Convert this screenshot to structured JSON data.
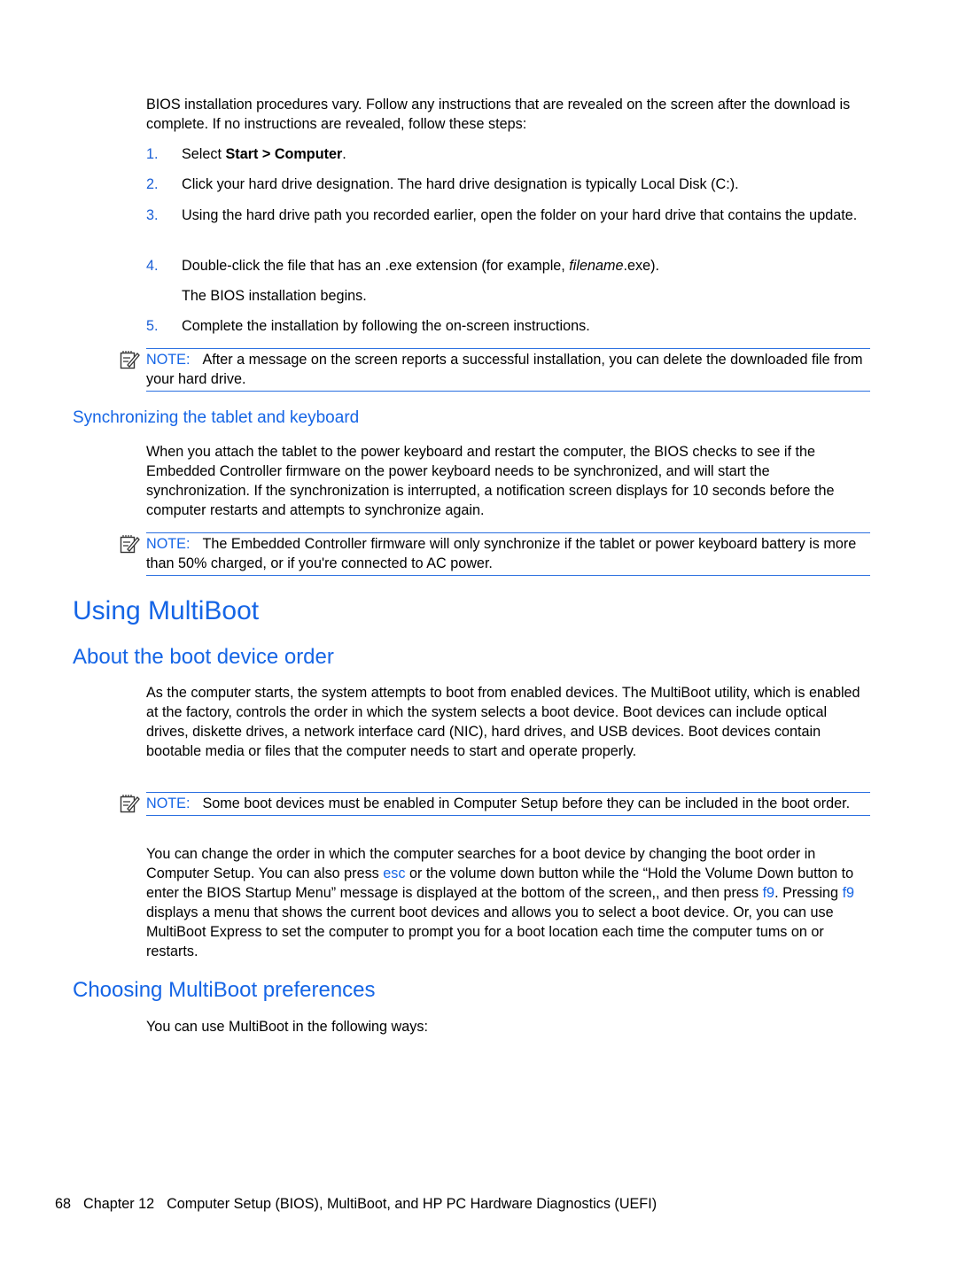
{
  "intro": {
    "text": "BIOS installation procedures vary. Follow any instructions that are revealed on the screen after the download is complete. If no instructions are revealed, follow these steps:"
  },
  "steps": [
    {
      "num": "1.",
      "pre": "Select ",
      "bold": "Start > Computer",
      "post": "."
    },
    {
      "num": "2.",
      "text": "Click your hard drive designation. The hard drive designation is typically Local Disk (C:)."
    },
    {
      "num": "3.",
      "text": "Using the hard drive path you recorded earlier, open the folder on your hard drive that contains the update."
    },
    {
      "num": "4.",
      "pre": "Double-click the file that has an .exe extension (for example, ",
      "italic": "filename",
      "post": ".exe).",
      "sub": "The BIOS installation begins."
    },
    {
      "num": "5.",
      "text": "Complete the installation by following the on-screen instructions."
    }
  ],
  "note_label": "NOTE:",
  "notes": [
    {
      "text": "After a message on the screen reports a successful installation, you can delete the downloaded file from your hard drive."
    },
    {
      "text": "The Embedded Controller firmware will only synchronize if the tablet or power keyboard battery is more than 50% charged, or if you're connected to AC power."
    },
    {
      "text": "Some boot devices must be enabled in Computer Setup before they can be included in the boot order."
    }
  ],
  "sections": {
    "sync": {
      "heading": "Synchronizing the tablet and keyboard",
      "body": "When you attach the tablet to the power keyboard and restart the computer, the BIOS checks to see if the Embedded Controller firmware on the power keyboard needs to be synchronized, and will start the synchronization. If the synchronization is interrupted, a notification screen displays for 10 seconds before the computer restarts and attempts to synchronize again."
    },
    "multiboot": {
      "heading": "Using MultiBoot"
    },
    "boot_order": {
      "heading": "About the boot device order",
      "body": "As the computer starts, the system attempts to boot from enabled devices. The MultiBoot utility, which is enabled at the factory, controls the order in which the system selects a boot device. Boot devices can include optical drives, diskette drives, a network interface card (NIC), hard drives, and USB devices. Boot devices contain bootable media or files that the computer needs to start and operate properly.",
      "body2": {
        "p1": "You can change the order in which the computer searches for a boot device by changing the boot order in Computer Setup. You can also press ",
        "key1": "esc",
        "p2": " or the volume down button while the “Hold the Volume Down button to enter the BIOS Startup Menu” message is displayed at the bottom of the screen,, and then press ",
        "key2": "f9",
        "p3": ". Pressing ",
        "key3": "f9",
        "p4": " displays a menu that shows the current boot devices and allows you to select a boot device. Or, you can use MultiBoot Express to set the computer to prompt you for a boot location each time the computer tums on or restarts."
      }
    },
    "preferences": {
      "heading": "Choosing MultiBoot preferences",
      "body": "You can use MultiBoot in the following ways:"
    }
  },
  "footer": {
    "page": "68",
    "chapter": "Chapter 12",
    "title": "Computer Setup (BIOS), MultiBoot, and HP PC Hardware Diagnostics (UEFI)"
  }
}
